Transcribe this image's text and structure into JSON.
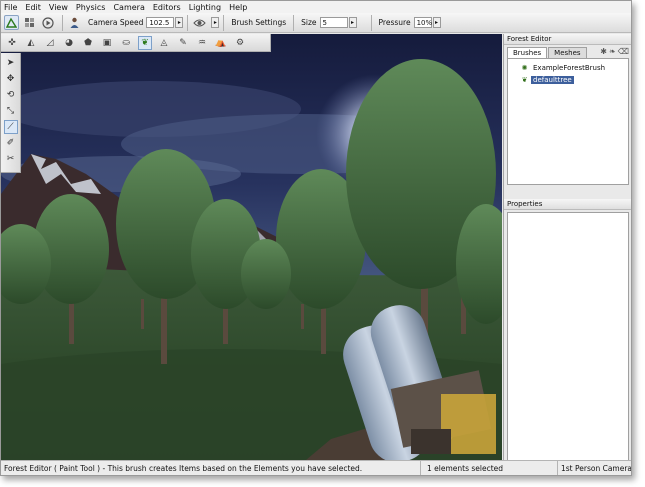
{
  "menu": [
    "File",
    "Edit",
    "View",
    "Physics",
    "Camera",
    "Editors",
    "Lighting",
    "Help"
  ],
  "toolbar": {
    "camera_speed_label": "Camera Speed",
    "camera_speed_value": "102.5",
    "brush_settings_label": "Brush Settings",
    "size_label": "Size",
    "size_value": "5",
    "pressure_label": "Pressure",
    "pressure_value": "10%"
  },
  "panel": {
    "title": "Forest Editor",
    "tabs": [
      "Brushes",
      "Meshes"
    ],
    "brushes": [
      "ExampleForestBrush",
      "defaulttree"
    ],
    "selected_brush": "defaulttree",
    "properties_title": "Properties"
  },
  "status": {
    "message": "Forest Editor ( Paint Tool ) - This brush creates Items based on the Elements you have selected.",
    "selection": "1 elements selected",
    "camera": "1st Person Camera"
  },
  "icons": {
    "toolbar": [
      "editor-mode-icon",
      "world-editor-icon",
      "play-icon",
      "camera-speed-icon",
      "visibility-icon"
    ],
    "tool_row": [
      "object-icon",
      "terrain-icon",
      "terrain-paint-icon",
      "material-icon",
      "shape-icon",
      "mesh-icon",
      "road-icon",
      "forest-icon",
      "particle-icon",
      "decal-icon",
      "river-icon",
      "convex-icon",
      "sound-icon"
    ],
    "side_palette": [
      "select-arrow-icon",
      "move-icon",
      "rotate-icon",
      "scale-icon",
      "paint-brush-icon",
      "erase-brush-icon",
      "erase-selected-icon"
    ]
  },
  "colors": {
    "selection": "#3d5f9c",
    "sky": "#1a2248",
    "grass": "#2f4f2f"
  }
}
